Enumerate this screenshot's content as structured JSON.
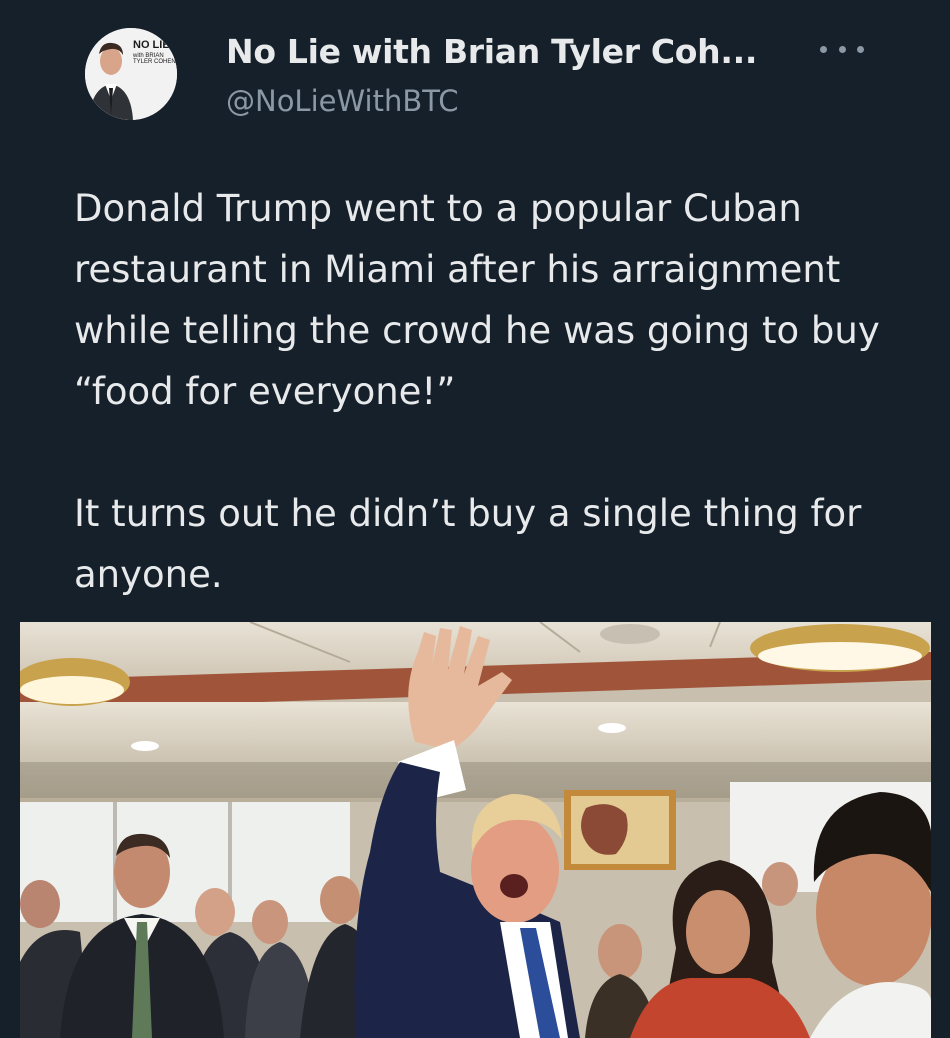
{
  "tweet": {
    "author": {
      "display_name": "No Lie with Brian Tyler Coh...",
      "handle": "@NoLieWithBTC",
      "avatar": {
        "logo_line1": "NO LIE",
        "logo_line2": "with BRIAN TYLER COHEN"
      }
    },
    "more_icon": "more-horizontal-icon",
    "paragraphs": [
      "Donald Trump went to a popular Cuban restaurant in Miami after his arraignment while telling the crowd he was going to buy “food for everyone!”",
      "It turns out he didn’t buy a single thing for anyone."
    ]
  },
  "colors": {
    "background": "#15202b",
    "primary_text": "#e7e9ea",
    "secondary_text": "#8b98a5"
  }
}
